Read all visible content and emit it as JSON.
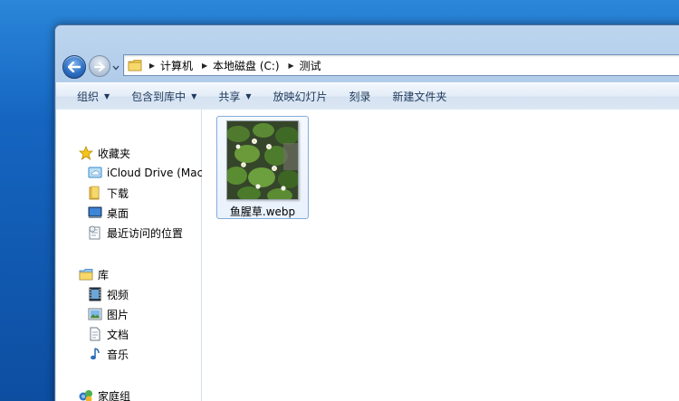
{
  "address": {
    "crumbs": [
      "计算机",
      "本地磁盘 (C:)",
      "测试"
    ]
  },
  "toolbar": {
    "organize": "组织",
    "include_in_library": "包含到库中",
    "share": "共享",
    "slideshow": "放映幻灯片",
    "burn": "刻录",
    "new_folder": "新建文件夹"
  },
  "sidebar": {
    "favorites_label": "收藏夹",
    "favorites": [
      {
        "label": "iCloud Drive (Mac)",
        "icon": "cloud-drive-icon"
      },
      {
        "label": "下载",
        "icon": "folder-download-icon"
      },
      {
        "label": "桌面",
        "icon": "desktop-icon"
      },
      {
        "label": "最近访问的位置",
        "icon": "recent-places-icon"
      }
    ],
    "libraries_label": "库",
    "libraries": [
      {
        "label": "视频",
        "icon": "video-library-icon"
      },
      {
        "label": "图片",
        "icon": "picture-library-icon"
      },
      {
        "label": "文档",
        "icon": "document-library-icon"
      },
      {
        "label": "音乐",
        "icon": "music-library-icon"
      }
    ],
    "homegroup_label": "家庭组"
  },
  "files": [
    {
      "name": "鱼腥草.webp",
      "icon": "image-thumbnail"
    }
  ],
  "colors": {
    "accent": "#1e395b",
    "selection_border": "#84acdd",
    "desktop_blue": "#1565c0"
  }
}
